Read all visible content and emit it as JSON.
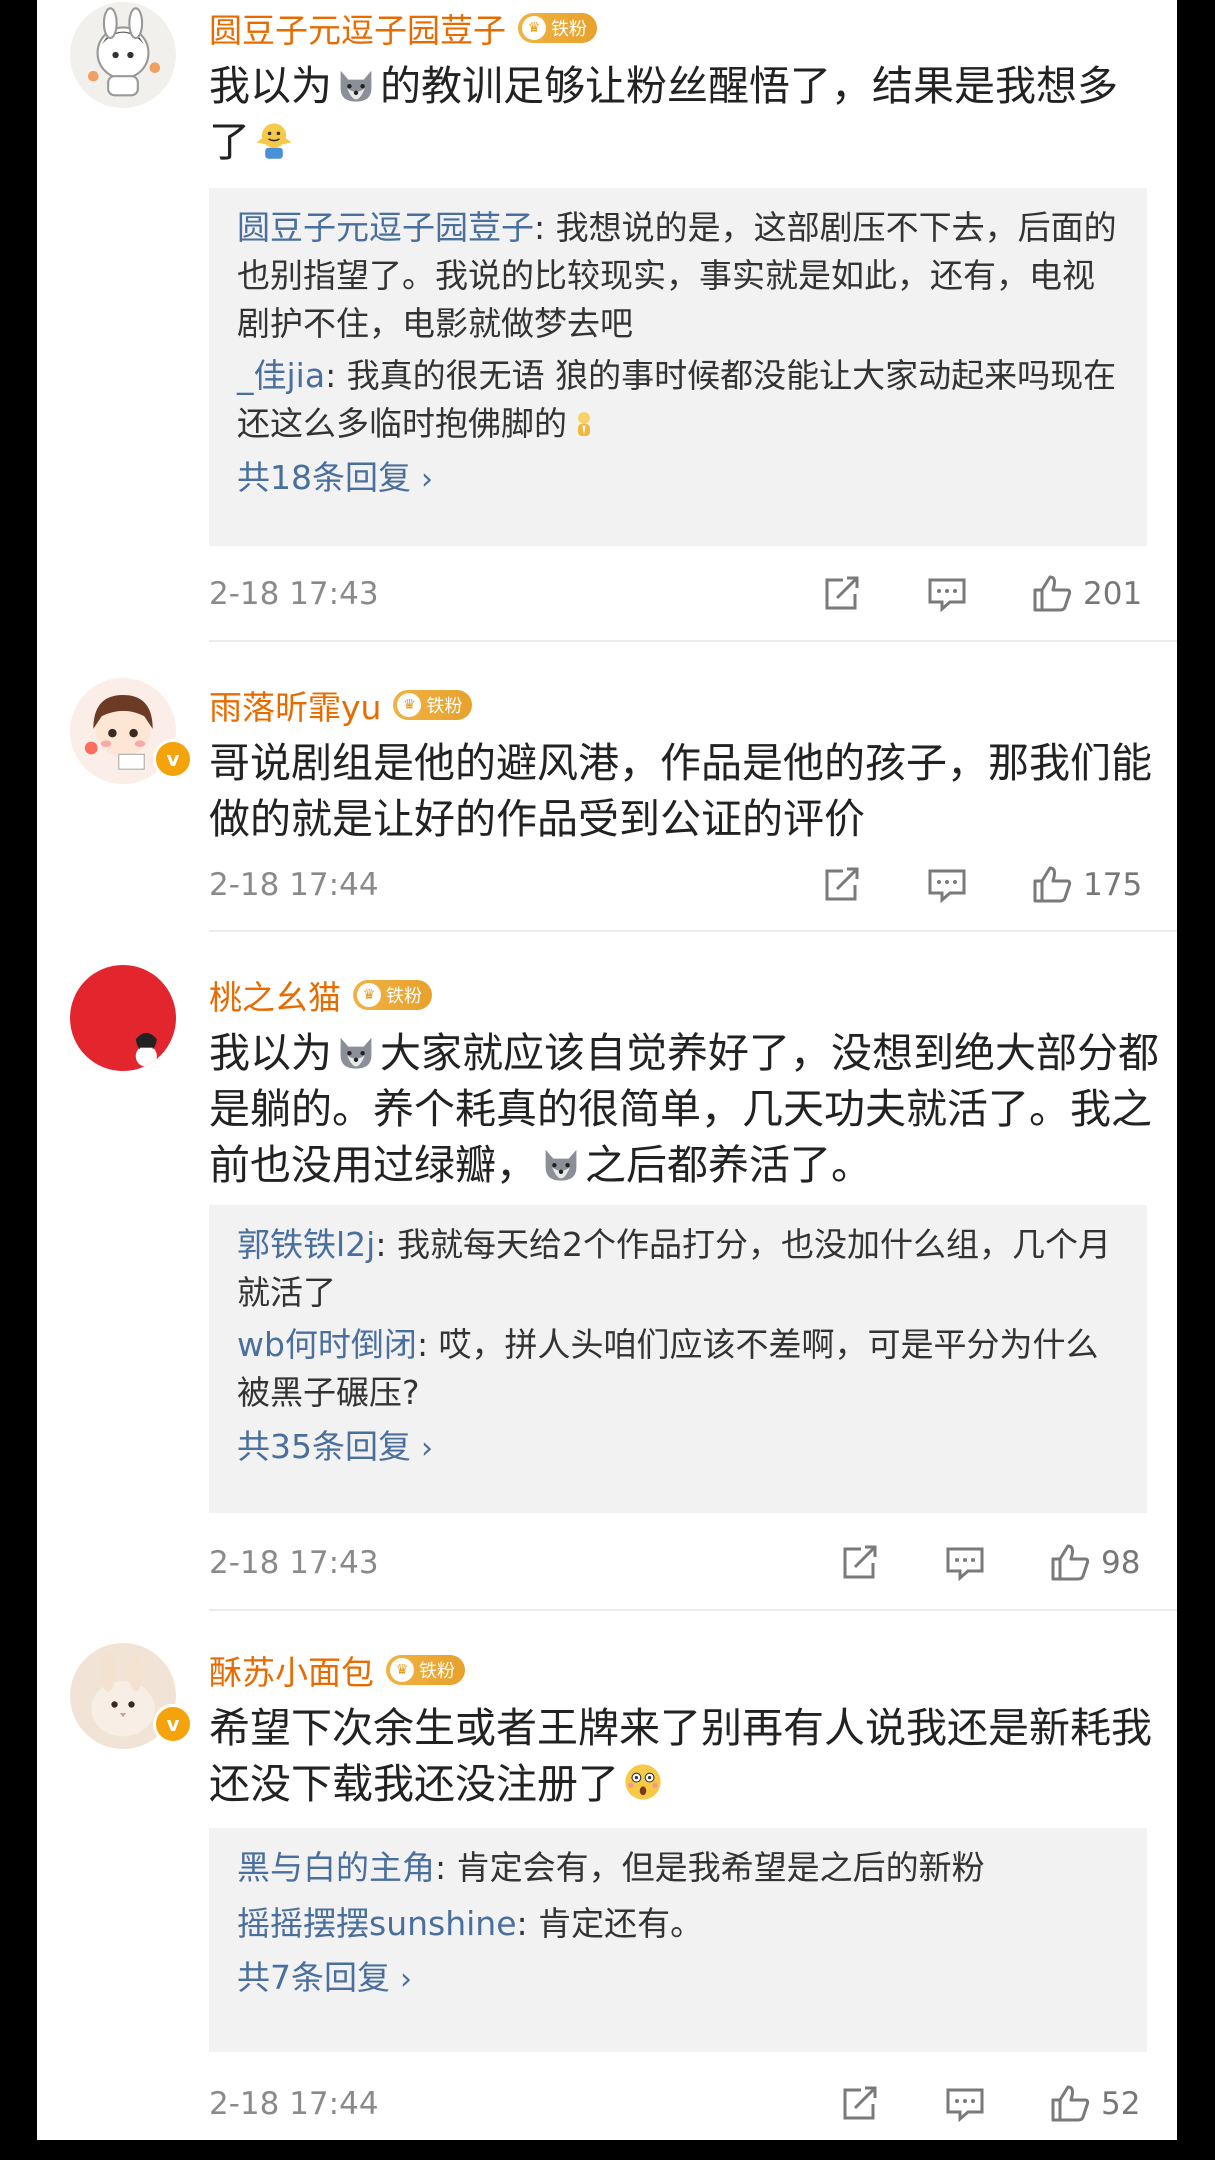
{
  "comments": [
    {
      "name": "圆豆子元逗子园荳子",
      "fan_badge": "铁粉",
      "verified": false,
      "text_parts": [
        "我以为",
        "[wolf]",
        "的教训足够让粉丝醒悟了，结果是我想多",
        "\n",
        "了",
        "[shrug]"
      ],
      "replies": [
        {
          "name": "圆豆子元逗子园荳子",
          "text": "我想说的是，这部剧压不下去，后面的也别指望了。我说的比较现实，事实就是如此，还有，电视剧护不住，电影就做梦去吧"
        },
        {
          "name": "_佳jia",
          "text": "我真的很无语 狼的事时候都没能让大家动起来吗现在还这么多临时抱佛脚的"
        }
      ],
      "more_replies": "共18条回复",
      "time": "2-18 17:43",
      "likes": "201"
    },
    {
      "name": "雨落昕霏yu",
      "fan_badge": "铁粉",
      "verified": true,
      "text_parts": [
        "哥说剧组是他的避风港，作品是他的孩子，那我们能做的就是让好的作品受到公证的评价"
      ],
      "replies": [],
      "more_replies": "",
      "time": "2-18 17:44",
      "likes": "175"
    },
    {
      "name": "桃之幺猫",
      "fan_badge": "铁粉",
      "verified": false,
      "text_parts": [
        "我以为",
        "[wolf]",
        "大家就应该自觉养好了，没想到绝大部分都是躺的。养个耗真的很简单，几天功夫就活了。我之前也没用过绿瓣，",
        "[wolf]",
        "之后都养活了。"
      ],
      "replies": [
        {
          "name": "郭铁铁l2j",
          "text": "我就每天给2个作品打分，也没加什么组，几个月就活了"
        },
        {
          "name": "wb何时倒闭",
          "text": "哎，拼人头咱们应该不差啊，可是平分为什么被黑子碾压?"
        }
      ],
      "more_replies": "共35条回复",
      "time": "2-18 17:43",
      "likes": "98"
    },
    {
      "name": "酥苏小面包",
      "fan_badge": "铁粉",
      "verified": true,
      "text_parts": [
        "希望下次余生或者王牌来了别再有人说我还是新耗我还没下载我还没注册了",
        "[shock]"
      ],
      "replies": [
        {
          "name": "黑与白的主角",
          "text": "肯定会有，但是我希望是之后的新粉"
        },
        {
          "name": "摇摇摆摆sunshine",
          "text": "肯定还有。"
        }
      ],
      "more_replies": "共7条回复",
      "time": "2-18 17:44",
      "likes": "52"
    }
  ],
  "icons": {
    "share": "share-icon",
    "comment": "comment-icon",
    "like": "thumbs-up-icon",
    "more": "chevron-right-icon"
  },
  "colors": {
    "username": "#e86b00",
    "reply_name": "#4a6f9c",
    "badge": "#f1b243"
  }
}
